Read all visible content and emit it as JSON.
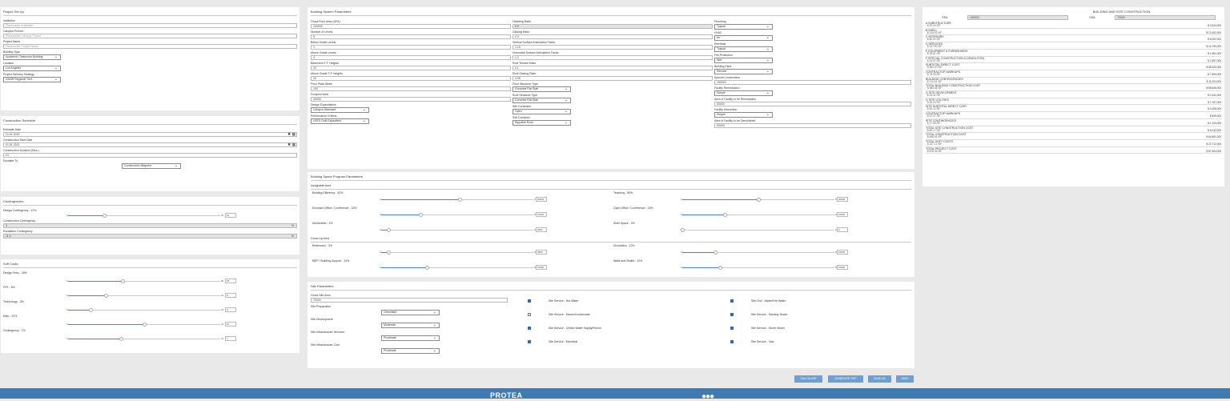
{
  "project_setup": {
    "title": "Project Set Up",
    "institution": {
      "label": "Institution",
      "placeholder": "Placeconter Institution"
    },
    "campus": {
      "label": "Campus Precint",
      "placeholder": "Placeconter Campus Precint"
    },
    "project_name": {
      "label": "Project Name",
      "placeholder": "Placeconter Project Name"
    },
    "building_type": {
      "label": "Building Type",
      "value": "Academic Classroom Building"
    },
    "location": {
      "label": "Location",
      "value": "Los Angeles"
    },
    "delivery": {
      "label": "Project Delivery Strategy",
      "value": "CMAR Regional Tier1"
    }
  },
  "schedule": {
    "title": "Construction Schedule",
    "estimate_date": {
      "label": "Estimate Date",
      "value": "01.01.2020"
    },
    "start_date": {
      "label": "Construction Start Date",
      "value": "01.01.2021"
    },
    "duration": {
      "label": "Construction Duration (Mos.)",
      "value": "24"
    },
    "escalate": {
      "label": "Escalate To",
      "value": "Construction Midpoint"
    }
  },
  "contingencies": {
    "title": "Contingencies",
    "design": {
      "label": "Design Contingency - 12%",
      "min": "0",
      "max": "50",
      "value": "12",
      "fraction": 0.24
    },
    "construction": {
      "label": "Construction Contingency",
      "value": "3",
      "unit": "%"
    },
    "escalation": {
      "label": "Escalation Contingency",
      "value": "11.6",
      "unit": "%"
    }
  },
  "soft_costs": {
    "title": "Soft Costs",
    "items": [
      {
        "label": "Design Fees - 18%",
        "min": "0",
        "max": "50",
        "value": "18",
        "fraction": 0.36
      },
      {
        "label": "FFE - 5%",
        "min": "0",
        "max": "20",
        "value": "5",
        "fraction": 0.25
      },
      {
        "label": "Technology - 3%",
        "min": "0",
        "max": "20",
        "value": "3",
        "fraction": 0.15
      },
      {
        "label": "Misc - 10%",
        "min": "0",
        "max": "20",
        "value": "10",
        "fraction": 0.5
      },
      {
        "label": "Contingency - 7%",
        "min": "0",
        "max": "20",
        "value": "7",
        "fraction": 0.35
      }
    ]
  },
  "building_params": {
    "title": "Building System Parameters",
    "col1": [
      {
        "label": "Gross Floor Area (GFA)",
        "value": "100000"
      },
      {
        "label": "Number of Levels",
        "value": "5"
      },
      {
        "label": "Below Grade Levels",
        "value": "1"
      },
      {
        "label": "Above Grade Levels",
        "value": "4"
      },
      {
        "label": "Basement F-F Heights",
        "value": "20"
      },
      {
        "label": "Above Grade F-F Heights",
        "value": "20"
      },
      {
        "label": "Floor Plate Width",
        "value": "100"
      },
      {
        "label": "Footprint Area",
        "value": "20000"
      }
    ],
    "design_expectations": {
      "label": "Design Expectations",
      "value": "Campus Standard"
    },
    "performance_criteria": {
      "label": "Performance Criteria",
      "value": "LEED Gold Equivalent"
    },
    "col2": [
      {
        "label": "Cladding Ratio",
        "value": "0.9",
        "grey": true
      },
      {
        "label": "Glazing Ratio",
        "value": "0.3"
      },
      {
        "label": "Vertical Surface Articulation Factor",
        "value": "1.15"
      },
      {
        "label": "Horizontal Surface Articulation Factor",
        "value": "1.2"
      },
      {
        "label": "Roof Terrace Ratio",
        "value": "0.1"
      },
      {
        "label": "Roof Glazing Ratio",
        "value": "0.05"
      }
    ],
    "col2_selects": [
      {
        "label": "Floor Structure Type",
        "value": "Concrete Flat Slab"
      },
      {
        "label": "Roof Structure Type",
        "value": "Concrete Flat Slab"
      },
      {
        "label": "Site Constraint",
        "value": "Open"
      },
      {
        "label": "Soil Condition",
        "value": "Rippable Rock"
      }
    ],
    "col3": [
      {
        "label": "Plumbing",
        "value": "Typical",
        "type": "select"
      },
      {
        "label": "HVAC",
        "value": "Air",
        "type": "select"
      },
      {
        "label": "Electrical",
        "value": "Typical",
        "type": "select"
      },
      {
        "label": "Fire Protection",
        "value": "Wet",
        "type": "select"
      },
      {
        "label": "Building Plant",
        "value": "Remote",
        "type": "select"
      },
      {
        "label": "Special Construction",
        "value": "100000",
        "type": "input"
      },
      {
        "label": "Facility Remediation",
        "value": "Simple",
        "type": "select"
      },
      {
        "label": "Area of Facility to be Remediated",
        "value": "50000",
        "type": "input"
      },
      {
        "label": "Facility Demolition",
        "value": "Simple",
        "type": "select"
      },
      {
        "label": "Area of Facility to be Demolished",
        "value": "50000",
        "type": "input"
      }
    ]
  },
  "space_program": {
    "title": "Building Space Program Parameters",
    "assignable_title": "Assignable Area",
    "grossup_title": "Gross Up Area",
    "assignable": [
      {
        "label": "Building Efficiency - 62%",
        "min": "0",
        "max": "75",
        "value": "60000",
        "fraction": 0.52,
        "side": "left"
      },
      {
        "label": "Teaching - 55%",
        "min": "0",
        "max": "55",
        "value": "30000",
        "fraction": 0.5,
        "side": "right"
      },
      {
        "label": "Enclosed Office / Conference - 15%",
        "min": "0",
        "max": "20",
        "value": "10000",
        "fraction": 0.26,
        "side": "left"
      },
      {
        "label": "Open Office / Conference - 15%",
        "min": "0",
        "max": "20",
        "value": "10000",
        "fraction": 0.28,
        "side": "right"
      },
      {
        "label": "Kitchenette - 2%",
        "min": "0",
        "max": "20",
        "value": "3000",
        "fraction": 0.05,
        "side": "left"
      },
      {
        "label": "Shell Space - 0%",
        "min": "0",
        "max": "20",
        "value": "0",
        "fraction": 0.0,
        "side": "right"
      }
    ],
    "grossup": [
      {
        "label": "Restrooms - 3%",
        "min": "0",
        "max": "50",
        "value": "3000",
        "fraction": 0.05,
        "side": "left"
      },
      {
        "label": "Circulation - 12%",
        "min": "0",
        "max": "50",
        "value": "10000",
        "fraction": 0.22,
        "side": "right"
      },
      {
        "label": "MEP / Building Support - 13%",
        "min": "0",
        "max": "50",
        "value": "10000",
        "fraction": 0.3,
        "side": "left"
      },
      {
        "label": "Walls and Shafts - 10%",
        "min": "0",
        "max": "50",
        "value": "10000",
        "fraction": 0.25,
        "side": "right"
      }
    ]
  },
  "site_params": {
    "title": "Site Parameters",
    "gross_site_area": {
      "label": "Gross Site Area",
      "value": "70000"
    },
    "selects": [
      {
        "label": "Site Preparation",
        "value": "Greenfield"
      },
      {
        "label": "Site Development",
        "value": "Moderate"
      },
      {
        "label": "Site Infrastructure Services",
        "value": "Proximate"
      },
      {
        "label": "Site Infrastructure Cost",
        "value": "Proximate"
      }
    ],
    "services_left": [
      {
        "label": "Site Service - Hot Water",
        "checked": true
      },
      {
        "label": "Site Service - Steam/Condensate",
        "checked": false
      },
      {
        "label": "Site Service - Chilled Water Supply/Return",
        "checked": true
      },
      {
        "label": "Site Service - Electrical",
        "checked": true
      }
    ],
    "services_right": [
      {
        "label": "Site Civil - Water/Fire Water",
        "checked": true
      },
      {
        "label": "Site Service - Sanitary Sewer",
        "checked": true
      },
      {
        "label": "Site Service - Storm Sewer",
        "checked": true
      },
      {
        "label": "Site Service - Gas",
        "checked": true
      }
    ]
  },
  "cost_summary": {
    "title": "BUILDING AND SITE CONSTRUCTION",
    "gfa_label": "GFA:",
    "gfa_value": "100000",
    "gsa_label": "GSA:",
    "gsa_value": "70000",
    "rows": [
      {
        "name": "A SUBSTRUCTURE",
        "psf": "$ 33.24 /SF",
        "total": "$ 3,324,000"
      },
      {
        "name": "B SHELL",
        "psf": "$ 134.92 /SF",
        "total": "$ 13,492,000"
      },
      {
        "name": "C INTERIORS",
        "psf": "$ 60.02 /SF",
        "total": "$ 6,002,000"
      },
      {
        "name": "D SERVICES",
        "psf": "$ 147.90 /SF",
        "total": "$ 14,790,000"
      },
      {
        "name": "E EQUIPMENT & FURNISHINGS",
        "psf": "$ 19.61 /SF",
        "total": "$ 1,961,000"
      },
      {
        "name": "F SPECIAL CONSTRUCTION & DEMOLITION",
        "psf": "$ 16.97 /SF",
        "total": "$ 1,697,000"
      },
      {
        "name": "SUBTOTAL DIRECT COST",
        "psf": "$ 383.20 /SF",
        "total": "$ 38,320,000"
      },
      {
        "name": "CONTRACTOR MARKUPS",
        "psf": "$ 75.90 /SF",
        "total": "$ 7,590,000"
      },
      {
        "name": "BUILDING CONTINGENCIES",
        "psf": "$ 112.24 /SF",
        "total": "$ 11,224,000"
      },
      {
        "name": "TOTAL BUILDING CONSTRUCTION COST",
        "psf": "$ 585.46 /SF",
        "total": "$ 58,546,000"
      },
      {
        "name": "G SITE DEVELOPMENT",
        "psf": "$ 24.41 /SF",
        "total": "$ 2,441,000"
      },
      {
        "name": "G SITE UTILITIES",
        "psf": "$ 25.24 /SF",
        "total": "$ 1,767,000"
      },
      {
        "name": "SITE SUBTOTAL DIRECT COST",
        "psf": "$ 60.11 /SF",
        "total": "$ 4,208,000"
      },
      {
        "name": "CONTRACTOR MARKUPS",
        "psf": "$ 12.07 /SF",
        "total": "$ 845,000"
      },
      {
        "name": "SITE CONTINGENCIES",
        "psf": "$ 17.05 /SF",
        "total": "$ 1,194,000"
      },
      {
        "name": "TOTAL SITE CONSTRUCTION COST",
        "psf": "$ 89.17 /SF",
        "total": "$ 6,242,000"
      },
      {
        "name": "TOTAL CONSTRUCTION COST",
        "psf": "$ 648.91 /SF",
        "total": "$ 64,891,000"
      },
      {
        "name": "TOTAL SOFT COSTS",
        "psf": "$ 227.12 /SF",
        "total": "$ 22,712,000"
      },
      {
        "name": "TOTAL PROJECT COST",
        "psf": "$ 876.03 /SF",
        "total": "$ 87,603,000"
      }
    ]
  },
  "actions": {
    "calculate": "CALCULATE",
    "generate_pdf": "GENERATE PDF",
    "save_as": "SAVE AS",
    "save": "SAVE"
  },
  "footer": {
    "logo": "PROTEA"
  },
  "colors": {
    "accent": "#6d9fd0",
    "footer": "#3d7bb4",
    "slider": "#4a86c5"
  }
}
